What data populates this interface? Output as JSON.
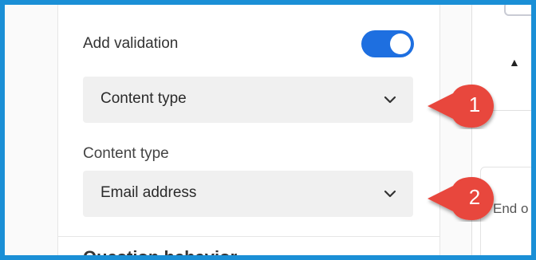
{
  "validation": {
    "label": "Add validation",
    "toggle_on": true,
    "accent": "#1e6fe0"
  },
  "select_primary": {
    "value": "Content type",
    "icon": "chevron-down-icon"
  },
  "content_type": {
    "label": "Content type",
    "value": "Email address",
    "icon": "chevron-down-icon"
  },
  "partial_heading": "Question behavior",
  "right_panel": {
    "up_arrow": "▲",
    "text": "End o"
  },
  "callouts": [
    {
      "number": "1",
      "color": "#e8473c"
    },
    {
      "number": "2",
      "color": "#e8473c"
    }
  ],
  "frame_color": "#1a8fd6"
}
